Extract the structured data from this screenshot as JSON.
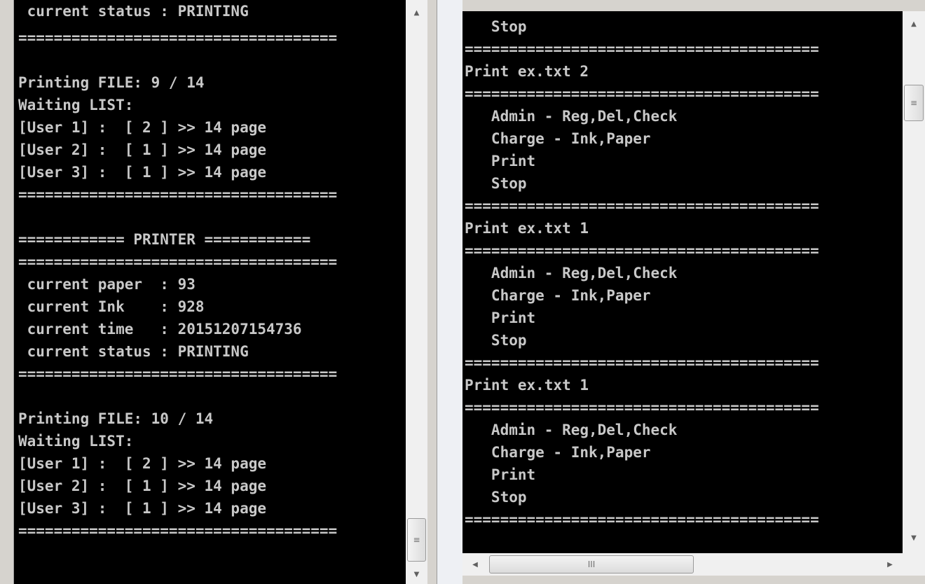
{
  "left_console": {
    "lines": [
      " current status : PRINTING",
      "====================================",
      "",
      "Printing FILE: 9 / 14",
      "Waiting LIST:",
      "[User 1] :  [ 2 ] >> 14 page",
      "[User 2] :  [ 1 ] >> 14 page",
      "[User 3] :  [ 1 ] >> 14 page",
      "====================================",
      "",
      "============ PRINTER ============",
      "====================================",
      " current paper  : 93",
      " current Ink    : 928",
      " current time   : 20151207154736",
      " current status : PRINTING",
      "====================================",
      "",
      "Printing FILE: 10 / 14",
      "Waiting LIST:",
      "[User 1] :  [ 2 ] >> 14 page",
      "[User 2] :  [ 1 ] >> 14 page",
      "[User 3] :  [ 1 ] >> 14 page",
      "===================================="
    ]
  },
  "right_console": {
    "lines": [
      "   Stop",
      "========================================",
      "Print ex.txt 2",
      "========================================",
      "   Admin - Reg,Del,Check",
      "   Charge - Ink,Paper",
      "   Print",
      "   Stop",
      "========================================",
      "Print ex.txt 1",
      "========================================",
      "   Admin - Reg,Del,Check",
      "   Charge - Ink,Paper",
      "   Print",
      "   Stop",
      "========================================",
      "Print ex.txt 1",
      "========================================",
      "   Admin - Reg,Del,Check",
      "   Charge - Ink,Paper",
      "   Print",
      "   Stop",
      "========================================"
    ]
  },
  "scrollbars": {
    "up_arrow": "▲",
    "down_arrow": "▼",
    "left_arrow": "◀",
    "right_arrow": "▶",
    "grip_v": "≡",
    "grip_h": "III"
  },
  "colors": {
    "console_bg": "#000000",
    "console_text": "#c8c8c8",
    "chrome": "#d6d3ce"
  }
}
